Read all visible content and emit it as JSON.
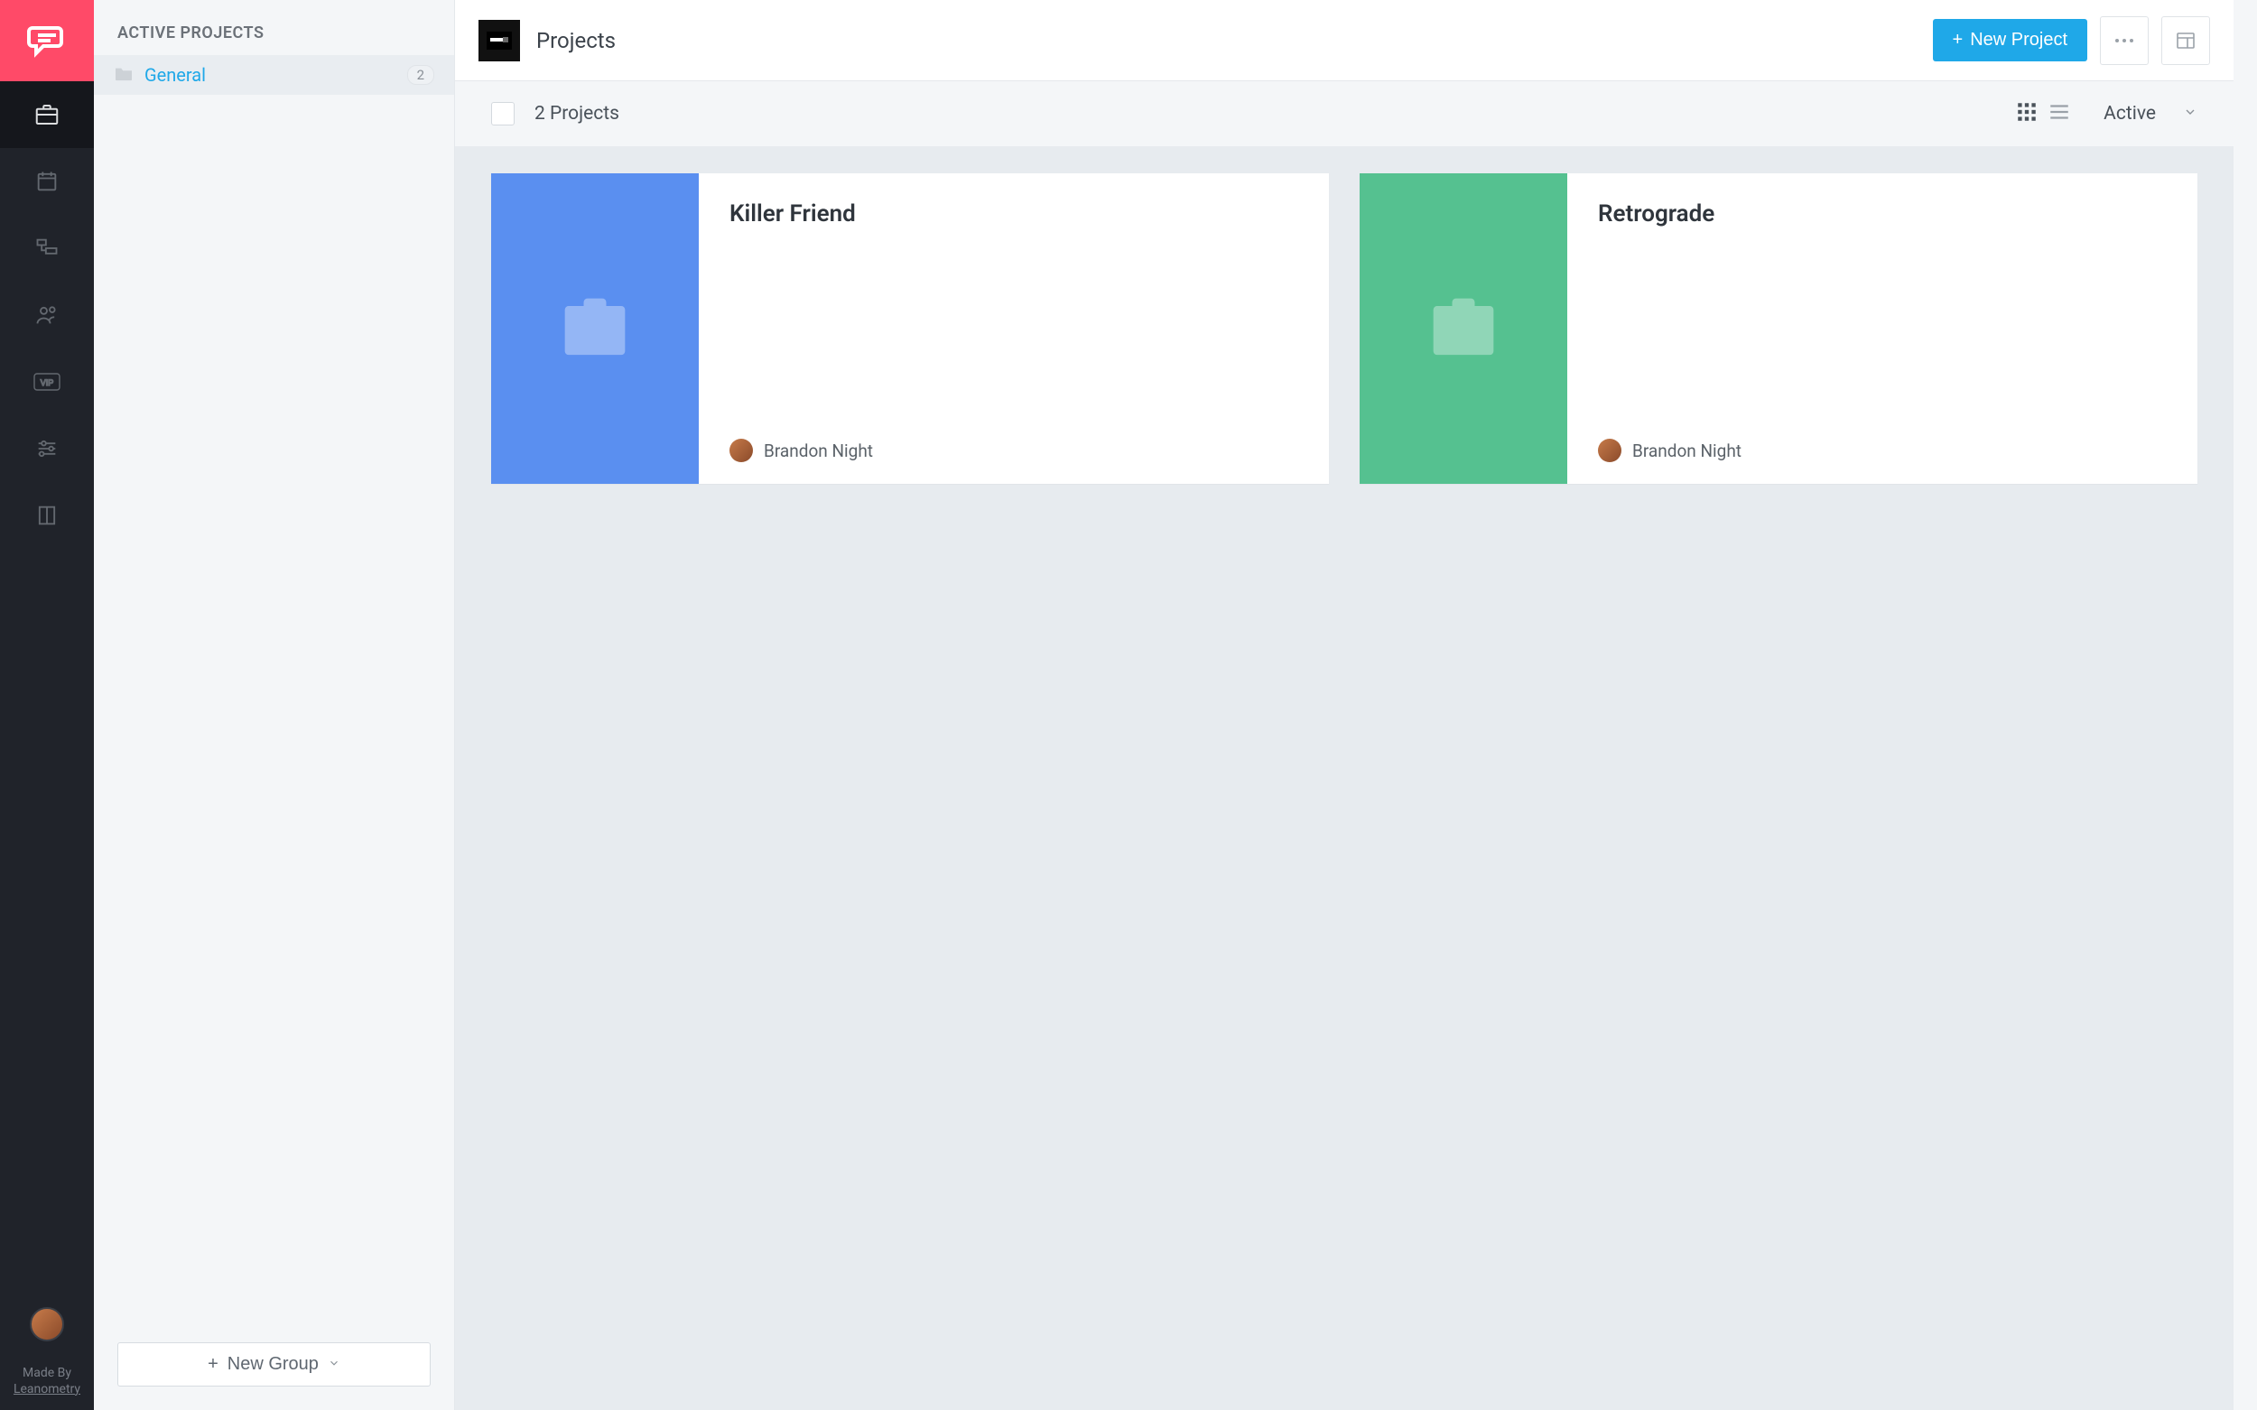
{
  "rail": {
    "credit_line1": "Made By",
    "credit_line2": "Leanometry"
  },
  "sidebar": {
    "header": "ACTIVE PROJECTS",
    "groups": [
      {
        "label": "General",
        "count": "2"
      }
    ],
    "new_group_label": "New Group"
  },
  "topbar": {
    "title": "Projects",
    "new_project_label": "New Project"
  },
  "filterbar": {
    "count_text": "2 Projects",
    "filter_label": "Active"
  },
  "projects": [
    {
      "title": "Killer Friend",
      "owner": "Brandon Night",
      "color": "blue"
    },
    {
      "title": "Retrograde",
      "owner": "Brandon Night",
      "color": "green"
    }
  ]
}
